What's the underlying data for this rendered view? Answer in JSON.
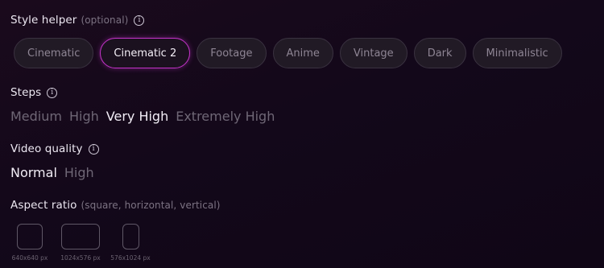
{
  "style_helper": {
    "title": "Style helper",
    "hint": "(optional)",
    "chips": [
      {
        "label": "Cinematic",
        "selected": false
      },
      {
        "label": "Cinematic 2",
        "selected": true
      },
      {
        "label": "Footage",
        "selected": false
      },
      {
        "label": "Anime",
        "selected": false
      },
      {
        "label": "Vintage",
        "selected": false
      },
      {
        "label": "Dark",
        "selected": false
      },
      {
        "label": "Minimalistic",
        "selected": false
      }
    ]
  },
  "steps": {
    "title": "Steps",
    "options": [
      "Medium",
      "High",
      "Very High",
      "Extremely High"
    ],
    "selected": "Very High"
  },
  "video_quality": {
    "title": "Video quality",
    "options": [
      "Normal",
      "High"
    ],
    "selected": "Normal"
  },
  "aspect_ratio": {
    "title": "Aspect ratio",
    "hint": "(square, horizontal, vertical)",
    "options": [
      {
        "label": "640x640 px",
        "shape": "square"
      },
      {
        "label": "1024x576 px",
        "shape": "horizontal"
      },
      {
        "label": "576x1024 px",
        "shape": "vertical"
      }
    ]
  },
  "icons": {
    "info": "info-icon"
  },
  "colors": {
    "accent": "#c433c9",
    "background": "#13081a"
  }
}
